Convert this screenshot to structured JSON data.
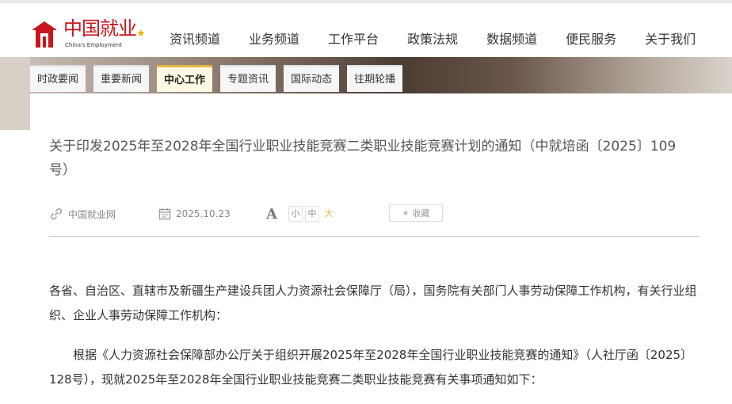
{
  "logo": {
    "cn": "中国就业",
    "en": "China's Employment",
    "brand_color": "#c9161d",
    "accent_color": "#f0b400",
    "icon": "logo-emblem-icon"
  },
  "nav": {
    "items": [
      "资讯频道",
      "业务频道",
      "工作平台",
      "政策法规",
      "数据频道",
      "便民服务",
      "关于我们"
    ]
  },
  "tabs": {
    "items": [
      "时政要闻",
      "重要新闻",
      "中心工作",
      "专题资讯",
      "国际动态",
      "往期轮播"
    ],
    "active": "中心工作",
    "active_color": "#e6b640"
  },
  "article": {
    "title": "关于印发2025年至2028年全国行业职业技能竞赛二类职业技能竞赛计划的通知（中就培函〔2025〕109号）",
    "source": "中国就业网",
    "date": "2025.10.23",
    "font_size_label": "A",
    "font_sizes": [
      "小",
      "中",
      "大"
    ],
    "font_size_selected": "大",
    "favorite_label": "收藏",
    "paragraphs": [
      "各省、自治区、直辖市及新疆生产建设兵团人力资源社会保障厅（局），国务院有关部门人事劳动保障工作机构，有关行业组织、企业人事劳动保障工作机构：",
      "根据《人力资源社会保障部办公厅关于组织开展2025年至2028年全国行业职业技能竞赛的通知》（人社厅函〔2025〕128号），现就2025年至2028年全国行业职业技能竞赛二类职业技能竞赛有关事项通知如下："
    ]
  }
}
